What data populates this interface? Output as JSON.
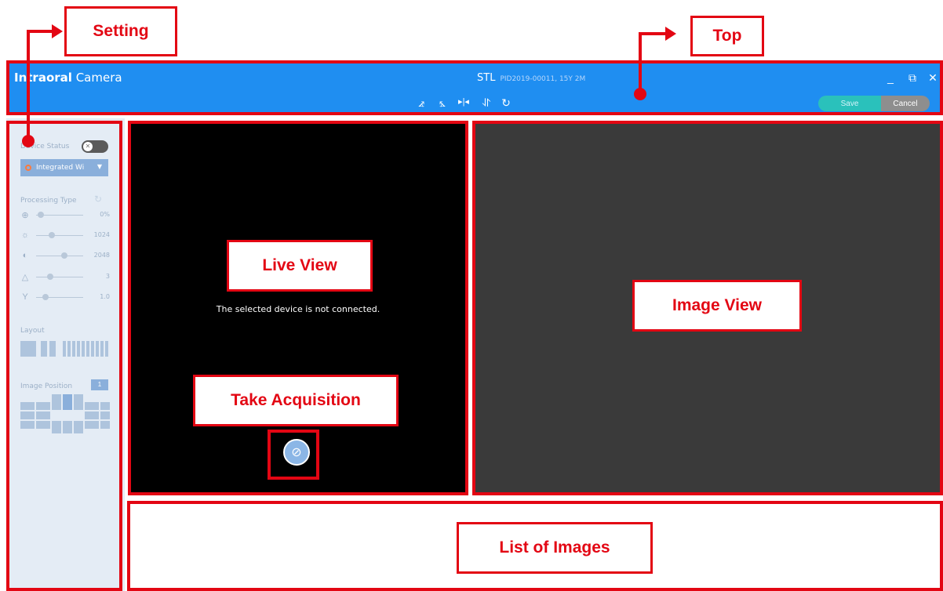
{
  "callouts": {
    "setting": "Setting",
    "top": "Top",
    "live_view": "Live View",
    "image_view": "Image View",
    "take_acquisition": "Take Acquisition",
    "list_of_images": "List of Images"
  },
  "topbar": {
    "app_title_bold": "Intraoral",
    "app_title_rest": " Camera",
    "patient_name": "STL",
    "patient_info": "PID2019-00011, 15Y 2M",
    "tools": [
      "rotate-left-icon",
      "rotate-right-icon",
      "flip-horizontal-icon",
      "flip-vertical-icon",
      "reset-icon"
    ],
    "save_label": "Save",
    "cancel_label": "Cancel",
    "accent_color": "#1f8ef1"
  },
  "settings": {
    "device_status_label": "Device Status",
    "device_select_value": "Integrated Wi",
    "processing_type_label": "Processing Type",
    "sliders": [
      {
        "icon": "zoom-icon",
        "value": "0%"
      },
      {
        "icon": "brightness-icon",
        "value": "1024"
      },
      {
        "icon": "contrast-icon",
        "value": "2048"
      },
      {
        "icon": "sharpness-icon",
        "value": "3"
      },
      {
        "icon": "gamma-icon",
        "value": "1.0"
      }
    ],
    "layout_label": "Layout",
    "image_position_label": "Image Position",
    "image_position_badge": "1"
  },
  "liveview": {
    "message": "The selected device is not connected."
  }
}
